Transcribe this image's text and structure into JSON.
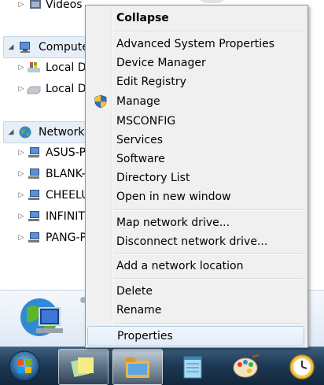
{
  "tree": {
    "videos": "Videos",
    "computer": "Compute",
    "local_disk_1": "Local D",
    "local_disk_2": "Local D",
    "network": "Network",
    "hosts": [
      "ASUS-P",
      "BLANK-",
      "CHEELU",
      "INFINIT",
      "PANG-P"
    ]
  },
  "context_menu": {
    "collapse": "Collapse",
    "items_group1": [
      "Advanced System Properties",
      "Device Manager",
      "Edit Registry",
      "Manage",
      "MSCONFIG",
      "Services",
      "Software",
      "Directory List",
      "Open in new window"
    ],
    "items_group2": [
      "Map network drive...",
      "Disconnect network drive..."
    ],
    "items_group3": [
      "Add a network location"
    ],
    "items_group4": [
      "Delete",
      "Rename"
    ],
    "properties": "Properties"
  },
  "icons": {
    "manage": "uac-shield-icon"
  },
  "colors": {
    "menu_bg": "#f0f0f0",
    "hover_border": "#aecbeb",
    "taskbar": "#1e3a56"
  }
}
